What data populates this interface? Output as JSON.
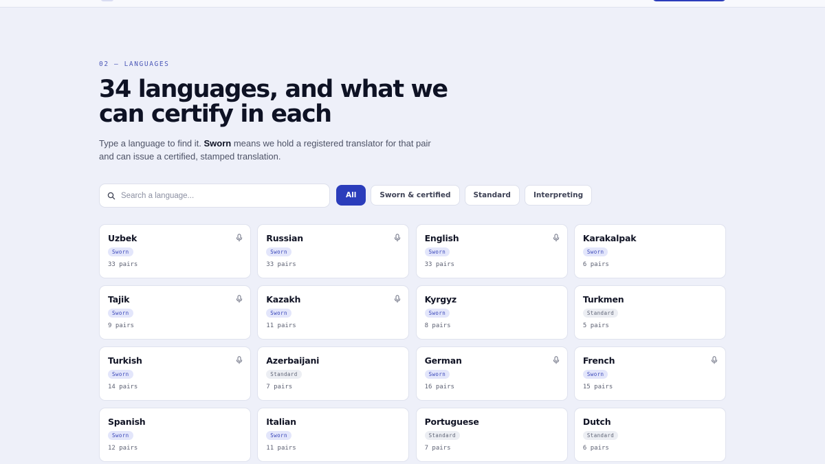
{
  "section": {
    "eyebrow": "02 — LANGUAGES",
    "title": "34 languages, and what we can certify in each",
    "subtitle_before": "Type a language to find it. ",
    "subtitle_bold": "Sworn",
    "subtitle_after": " means we hold a registered translator for that pair and can issue a certified, stamped translation."
  },
  "search": {
    "placeholder": "Search a language...",
    "value": "",
    "icon": "search-icon"
  },
  "filters": [
    {
      "label": "All",
      "active": true
    },
    {
      "label": "Sworn & certified",
      "active": false
    },
    {
      "label": "Standard",
      "active": false
    },
    {
      "label": "Interpreting",
      "active": false
    }
  ],
  "colors": {
    "accent": "#2b3dbb",
    "background": "#eef0f9",
    "sworn_badge_bg": "#e3e6fb",
    "standard_badge_bg": "#eceef3"
  },
  "languages": [
    {
      "name": "Uzbek",
      "badge": "Sworn",
      "pairs": "33 pairs",
      "interpreting": true
    },
    {
      "name": "Russian",
      "badge": "Sworn",
      "pairs": "33 pairs",
      "interpreting": true
    },
    {
      "name": "English",
      "badge": "Sworn",
      "pairs": "33 pairs",
      "interpreting": true
    },
    {
      "name": "Karakalpak",
      "badge": "Sworn",
      "pairs": "6 pairs",
      "interpreting": false
    },
    {
      "name": "Tajik",
      "badge": "Sworn",
      "pairs": "9 pairs",
      "interpreting": true
    },
    {
      "name": "Kazakh",
      "badge": "Sworn",
      "pairs": "11 pairs",
      "interpreting": true
    },
    {
      "name": "Kyrgyz",
      "badge": "Sworn",
      "pairs": "8 pairs",
      "interpreting": false
    },
    {
      "name": "Turkmen",
      "badge": "Standard",
      "pairs": "5 pairs",
      "interpreting": false
    },
    {
      "name": "Turkish",
      "badge": "Sworn",
      "pairs": "14 pairs",
      "interpreting": true
    },
    {
      "name": "Azerbaijani",
      "badge": "Standard",
      "pairs": "7 pairs",
      "interpreting": false
    },
    {
      "name": "German",
      "badge": "Sworn",
      "pairs": "16 pairs",
      "interpreting": true
    },
    {
      "name": "French",
      "badge": "Sworn",
      "pairs": "15 pairs",
      "interpreting": true
    },
    {
      "name": "Spanish",
      "badge": "Sworn",
      "pairs": "12 pairs",
      "interpreting": false
    },
    {
      "name": "Italian",
      "badge": "Sworn",
      "pairs": "11 pairs",
      "interpreting": false
    },
    {
      "name": "Portuguese",
      "badge": "Standard",
      "pairs": "7 pairs",
      "interpreting": false
    },
    {
      "name": "Dutch",
      "badge": "Standard",
      "pairs": "6 pairs",
      "interpreting": false
    }
  ]
}
